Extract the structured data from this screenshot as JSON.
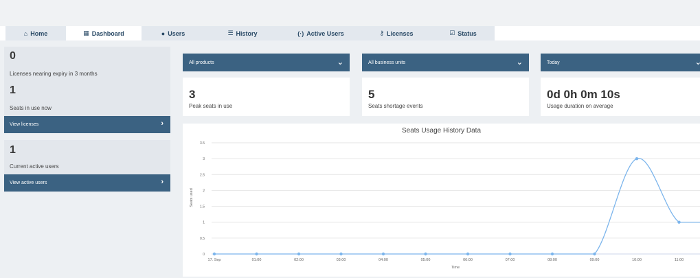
{
  "tabs": [
    {
      "label": "Home",
      "icon": "home-icon",
      "glyph": "🏠",
      "active": false
    },
    {
      "label": "Dashboard",
      "icon": "dashboard-icon",
      "glyph": "▪▪",
      "active": true
    },
    {
      "label": "Users",
      "icon": "user-icon",
      "glyph": "👤",
      "active": false
    },
    {
      "label": "History",
      "icon": "list-icon",
      "glyph": "☰",
      "active": false
    },
    {
      "label": "Active Users",
      "icon": "signal-icon",
      "glyph": "(·)",
      "active": false
    },
    {
      "label": "Licenses",
      "icon": "key-icon",
      "glyph": "⚿",
      "active": false
    },
    {
      "label": "Status",
      "icon": "checkbox-icon",
      "glyph": "☑",
      "active": false
    }
  ],
  "left": {
    "expiry_count": "0",
    "expiry_label": "Licenses nearing expiry in 3 months",
    "seats_count": "1",
    "seats_label": "Seats in use now",
    "view_licenses": "View licenses",
    "active_count": "1",
    "active_label": "Current active users",
    "view_active": "View active users"
  },
  "filters": {
    "products": "All products",
    "units": "All business units",
    "period": "Today"
  },
  "stats": {
    "peak_value": "3",
    "peak_label": "Peak seats in use",
    "shortage_value": "5",
    "shortage_label": "Seats shortage events",
    "duration_value": "0d 0h 0m 10s",
    "duration_label": "Usage duration on average"
  },
  "chart_data": {
    "type": "line",
    "title": "Seats Usage History Data",
    "xlabel": "Time",
    "ylabel": "Seats used",
    "ylim": [
      0,
      3.5
    ],
    "yticks": [
      "0",
      "0.5",
      "1",
      "1.5",
      "2",
      "2.5",
      "3",
      "3.5"
    ],
    "categories": [
      "17. Sep",
      "01:00",
      "02:00",
      "03:00",
      "04:00",
      "05:00",
      "06:00",
      "07:00",
      "08:00",
      "09:00",
      "10:00",
      "11:00"
    ],
    "series": [
      {
        "values": [
          0,
          0,
          0,
          0,
          0,
          0,
          0,
          0,
          0,
          0,
          3,
          1,
          1
        ],
        "color": "#7cb5ec"
      }
    ],
    "grid": true
  },
  "colors": {
    "accent": "#3b6282",
    "tab_text": "#2a4a66",
    "series": "#7cb5ec"
  }
}
